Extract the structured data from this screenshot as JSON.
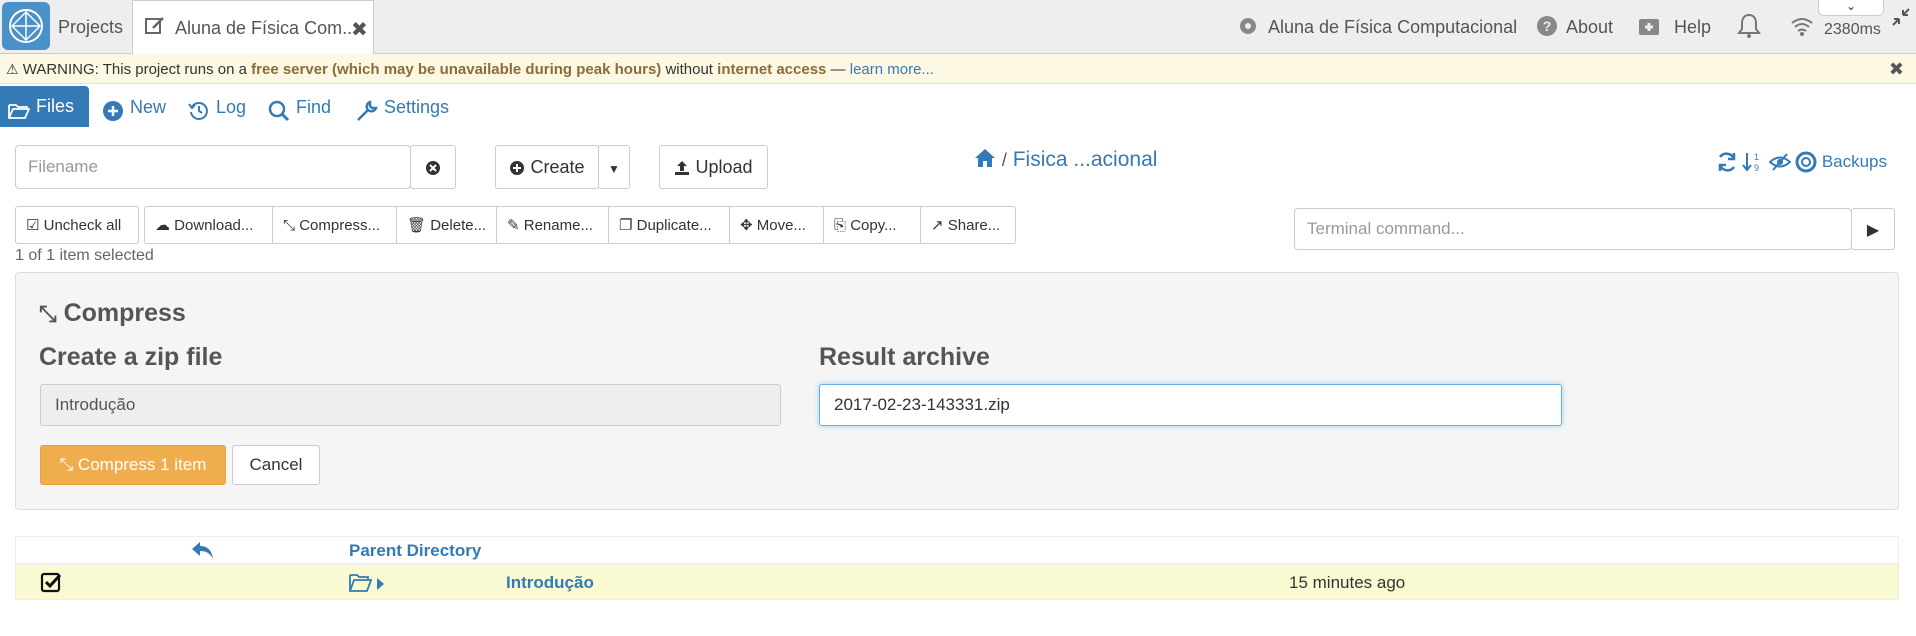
{
  "topbar": {
    "projects_label": "Projects",
    "tab_title": "Aluna de Física Com...",
    "project_name": "Aluna de Física Computacional",
    "about": "About",
    "help": "Help",
    "ping": "2380ms"
  },
  "warning": {
    "prefix": "WARNING: This project runs on a ",
    "bold1": "free server (which may be unavailable during peak hours)",
    "middle": " without ",
    "bold2": "internet access",
    "dash": " — ",
    "link": "learn more..."
  },
  "nav": {
    "files": "Files",
    "new": "New",
    "log": "Log",
    "find": "Find",
    "settings": "Settings"
  },
  "toolbar": {
    "filename_placeholder": "Filename",
    "create": "Create",
    "upload": "Upload",
    "breadcrumb_sep": "/",
    "breadcrumb_path": "Fisica ...acional",
    "backups": "Backups",
    "terminal_placeholder": "Terminal command..."
  },
  "actions": {
    "uncheck_all": "Uncheck all",
    "download": "Download...",
    "compress": "Compress...",
    "delete": "Delete...",
    "rename": "Rename...",
    "duplicate": "Duplicate...",
    "move": "Move...",
    "copy": "Copy...",
    "share": "Share..."
  },
  "selection_status": "1 of 1 item selected",
  "compress_panel": {
    "title": "Compress",
    "create_zip_label": "Create a zip file",
    "source_value": "Introdução",
    "result_label": "Result archive",
    "result_value": "2017-02-23-143331.zip",
    "compress_button": "Compress 1 item",
    "cancel_button": "Cancel"
  },
  "listing": {
    "parent_label": "Parent Directory",
    "rows": [
      {
        "name": "Introdução",
        "modified": "15 minutes ago",
        "checked": true
      }
    ]
  },
  "colors": {
    "accent": "#337ab7",
    "warning_bg": "#fcf8e3",
    "compress_btn": "#f0ad4e",
    "selected_row": "#fafad2"
  }
}
